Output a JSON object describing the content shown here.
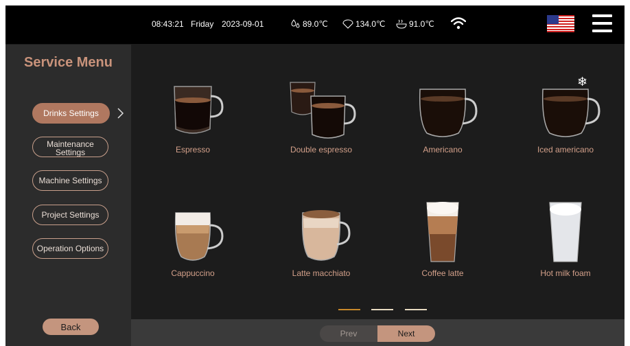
{
  "status": {
    "time": "08:43:21",
    "day": "Friday",
    "date": "2023-09-01",
    "temp1": "89.0℃",
    "temp2": "134.0℃",
    "temp3": "91.0℃"
  },
  "sidebar": {
    "title": "Service Menu",
    "items": [
      {
        "label": "Drinks Settings"
      },
      {
        "label": "Maintenance Settings"
      },
      {
        "label": "Machine Settings"
      },
      {
        "label": "Project Settings"
      },
      {
        "label": "Operation Options"
      }
    ],
    "back_label": "Back"
  },
  "drinks": [
    {
      "label": "Espresso",
      "icon": "espresso-cup-icon"
    },
    {
      "label": "Double espresso",
      "icon": "double-espresso-cup-icon"
    },
    {
      "label": "Americano",
      "icon": "americano-mug-icon"
    },
    {
      "label": "Iced americano",
      "icon": "iced-americano-mug-icon"
    },
    {
      "label": "Cappuccino",
      "icon": "cappuccino-mug-icon"
    },
    {
      "label": "Latte macchiato",
      "icon": "latte-macchiato-cup-icon"
    },
    {
      "label": "Coffee latte",
      "icon": "coffee-latte-glass-icon"
    },
    {
      "label": "Hot milk foam",
      "icon": "hot-milk-foam-glass-icon"
    }
  ],
  "pager": {
    "prev_label": "Prev",
    "next_label": "Next",
    "pages": 3,
    "current_page": 1
  },
  "colors": {
    "accent": "#c4957e",
    "label": "#d3a08a",
    "active_dot": "#c8892a"
  }
}
